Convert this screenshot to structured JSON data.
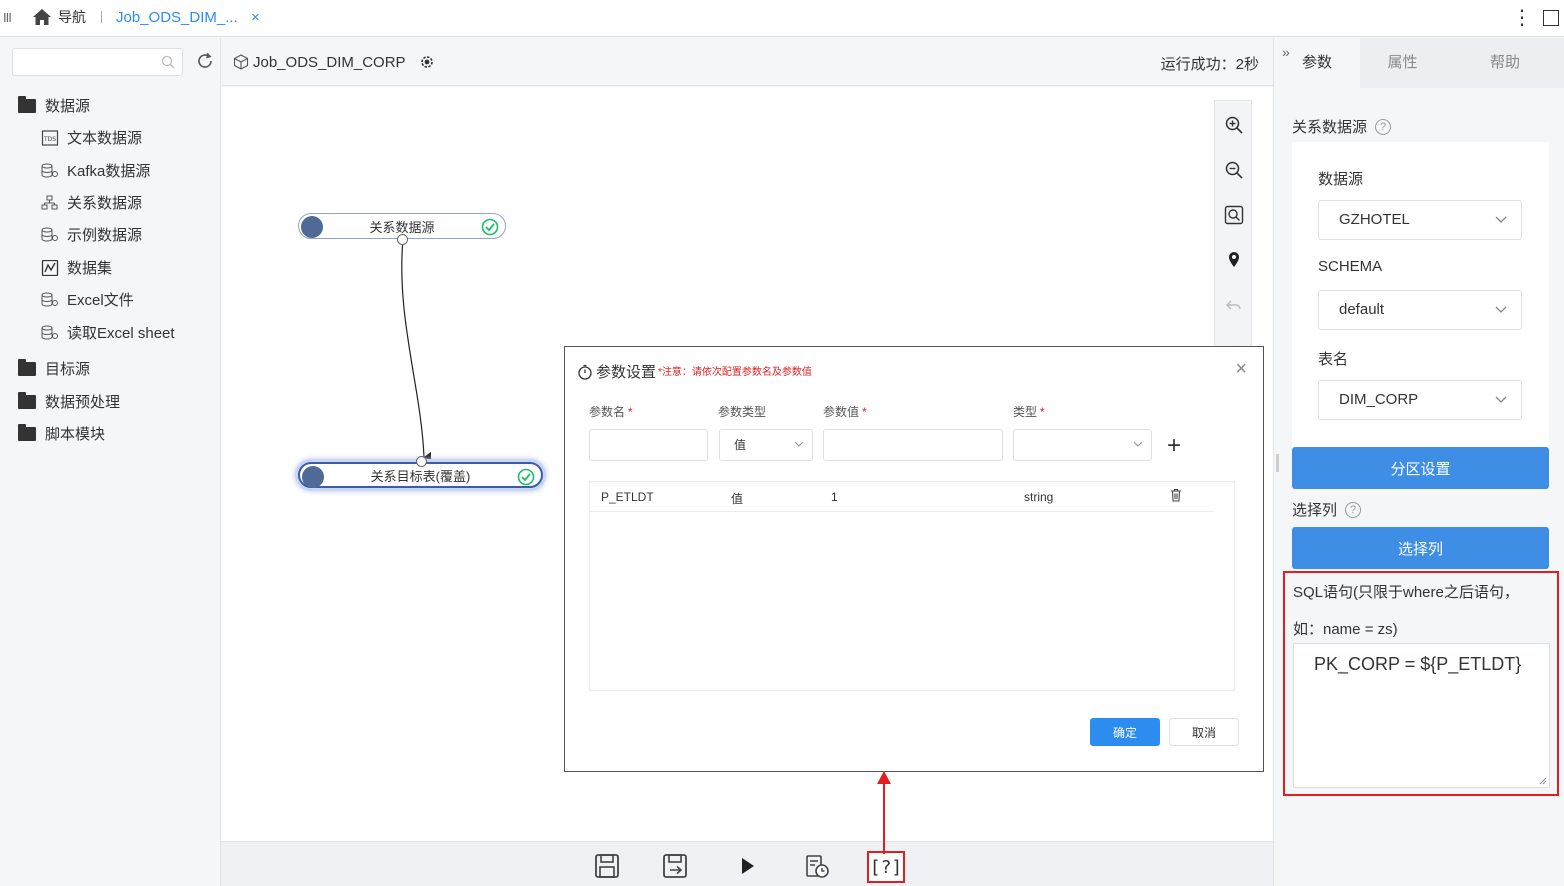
{
  "topbar": {
    "menu_icon": "III",
    "nav_label": "导航",
    "tab_label": "Job_ODS_DIM_...",
    "tab_close": "×",
    "more_icon": "⋮"
  },
  "sidebar": {
    "search_placeholder": "",
    "tree": [
      {
        "type": "folder",
        "label": "数据源"
      },
      {
        "type": "item",
        "label": "文本数据源",
        "icon": "text-datasource-icon"
      },
      {
        "type": "item",
        "label": "Kafka数据源",
        "icon": "database-icon"
      },
      {
        "type": "item",
        "label": "关系数据源",
        "icon": "relation-icon"
      },
      {
        "type": "item",
        "label": "示例数据源",
        "icon": "database-icon"
      },
      {
        "type": "item",
        "label": "数据集",
        "icon": "dataset-icon"
      },
      {
        "type": "item",
        "label": "Excel文件",
        "icon": "database-icon"
      },
      {
        "type": "item",
        "label": "读取Excel sheet",
        "icon": "database-icon"
      },
      {
        "type": "folder",
        "label": "目标源"
      },
      {
        "type": "folder",
        "label": "数据预处理"
      },
      {
        "type": "folder",
        "label": "脚本模块"
      }
    ]
  },
  "canvas": {
    "title": "Job_ODS_DIM_CORP",
    "status": "运行成功：2秒",
    "nodes": [
      {
        "label": "关系数据源",
        "status": "success"
      },
      {
        "label": "关系目标表(覆盖)",
        "status": "success"
      }
    ],
    "help_label": "[?]"
  },
  "dialog": {
    "title": "参数设置",
    "note": "*注意：请依次配置参数名及参数值",
    "headers": [
      "参数名",
      "参数类型",
      "参数值",
      "类型"
    ],
    "required": "*",
    "param_type_value": "值",
    "rows": [
      {
        "name": "P_ETLDT",
        "ptype": "值",
        "value": "1",
        "type": "string"
      }
    ],
    "ok_label": "确定",
    "cancel_label": "取消",
    "close": "×",
    "add": "+"
  },
  "rpanel": {
    "tabs": [
      "参数",
      "属性",
      "帮助"
    ],
    "active_tab": "参数",
    "section_label": "关系数据源",
    "datasource_label": "数据源",
    "datasource_value": "GZHOTEL",
    "schema_label": "SCHEMA",
    "schema_value": "default",
    "table_label": "表名",
    "table_value": "DIM_CORP",
    "partition_btn": "分区设置",
    "select_col_label": "选择列",
    "select_col_btn": "选择列",
    "sql_label_1": "SQL语句(只限于where之后语句，",
    "sql_label_2": "如：name = zs)",
    "sql_value": "PK_CORP = ${P_ETLDT}"
  },
  "colors": {
    "accent": "#2d8cf0",
    "button_blue": "#3e8ee5",
    "highlight_red": "#e02020",
    "node_icon": "#4f6a96",
    "success_green": "#19be6b"
  }
}
